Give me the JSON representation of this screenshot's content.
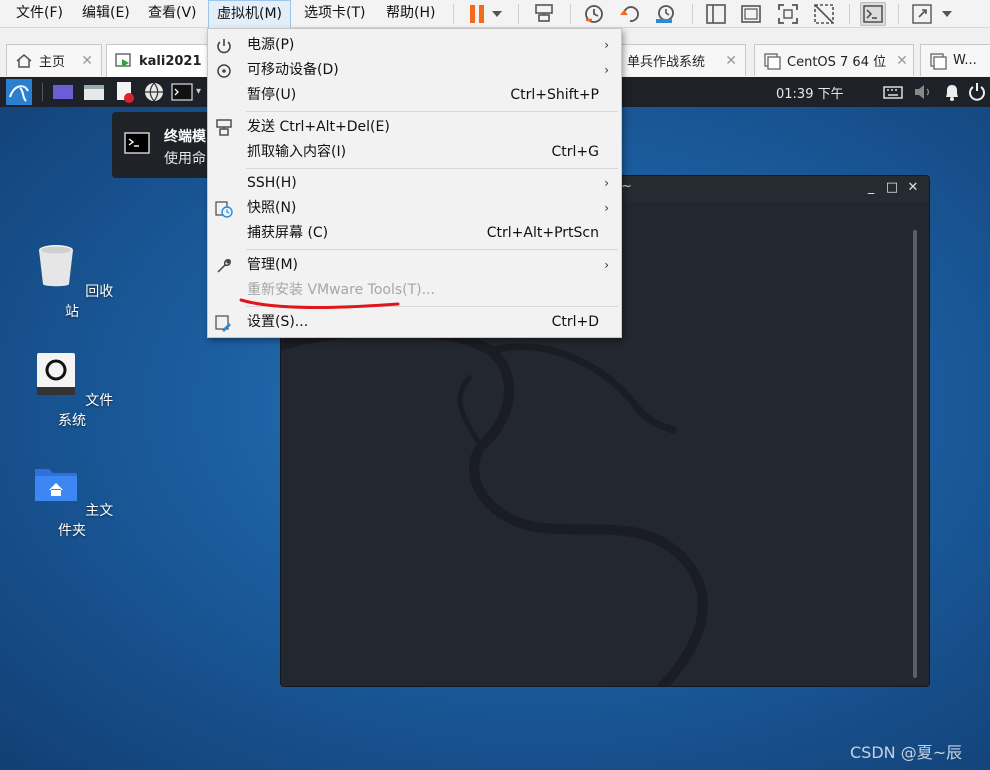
{
  "menubar": {
    "items": [
      "文件(F)",
      "编辑(E)",
      "查看(V)",
      "虚拟机(M)",
      "选项卡(T)",
      "帮助(H)"
    ],
    "active_index": 3
  },
  "toolbar": {
    "icons": [
      "pause-icon",
      "dropdown-caret-icon",
      "send-ctrl-alt-del-icon",
      "snapshot-icon",
      "revert-snapshot-icon",
      "snapshot-manager-icon",
      "single-view-icon",
      "multi-view-icon",
      "fullscreen-icon",
      "unity-icon",
      "console-icon",
      "stretch-icon",
      "dropdown-caret-icon"
    ],
    "accent_color": "#f26a1b"
  },
  "tabs": [
    {
      "label": "主页",
      "icon": "home-icon",
      "active": false
    },
    {
      "label": "kali2021",
      "icon": "vm-running-icon",
      "active": true
    },
    {
      "label": "单兵作战系统",
      "icon": "vm-icon",
      "active": false
    },
    {
      "label": "CentOS 7 64 位",
      "icon": "vm-icon",
      "active": false
    },
    {
      "label": "W...",
      "icon": "vm-icon",
      "active": false
    }
  ],
  "guest_panel": {
    "clock": "01:39 下午"
  },
  "notification": {
    "title": "终端模",
    "body": "使用命"
  },
  "desktop": {
    "icons": [
      {
        "label": "回收站",
        "icon": "trash-icon"
      },
      {
        "label": "文件系统",
        "icon": "drive-icon"
      },
      {
        "label": "主文件夹",
        "icon": "home-folder-icon"
      }
    ]
  },
  "terminal": {
    "title": "~",
    "buttons": [
      "_",
      "□",
      "✕"
    ]
  },
  "vm_menu": {
    "items": [
      {
        "label": "电源(P)",
        "icon": "power-icon",
        "shortcut": "",
        "submenu": true,
        "disabled": false
      },
      {
        "label": "可移动设备(D)",
        "icon": "removable-device-icon",
        "shortcut": "",
        "submenu": true,
        "disabled": false
      },
      {
        "label": "暂停(U)",
        "icon": "",
        "shortcut": "Ctrl+Shift+P",
        "submenu": false,
        "disabled": false
      },
      {
        "label": "发送 Ctrl+Alt+Del(E)",
        "icon": "send-keys-icon",
        "shortcut": "",
        "submenu": false,
        "disabled": false
      },
      {
        "label": "抓取输入内容(I)",
        "icon": "",
        "shortcut": "Ctrl+G",
        "submenu": false,
        "disabled": false
      },
      {
        "label": "SSH(H)",
        "icon": "",
        "shortcut": "",
        "submenu": true,
        "disabled": false
      },
      {
        "label": "快照(N)",
        "icon": "snapshot-icon",
        "shortcut": "",
        "submenu": true,
        "disabled": false
      },
      {
        "label": "捕获屏幕 (C)",
        "icon": "",
        "shortcut": "Ctrl+Alt+PrtScn",
        "submenu": false,
        "disabled": false
      },
      {
        "label": "管理(M)",
        "icon": "wrench-icon",
        "shortcut": "",
        "submenu": true,
        "disabled": false
      },
      {
        "label": "重新安装 VMware Tools(T)...",
        "icon": "",
        "shortcut": "",
        "submenu": false,
        "disabled": true
      },
      {
        "label": "设置(S)...",
        "icon": "settings-icon",
        "shortcut": "Ctrl+D",
        "submenu": false,
        "disabled": false
      }
    ],
    "annotation_color": "#e0161b"
  },
  "watermark": "CSDN @夏~辰"
}
